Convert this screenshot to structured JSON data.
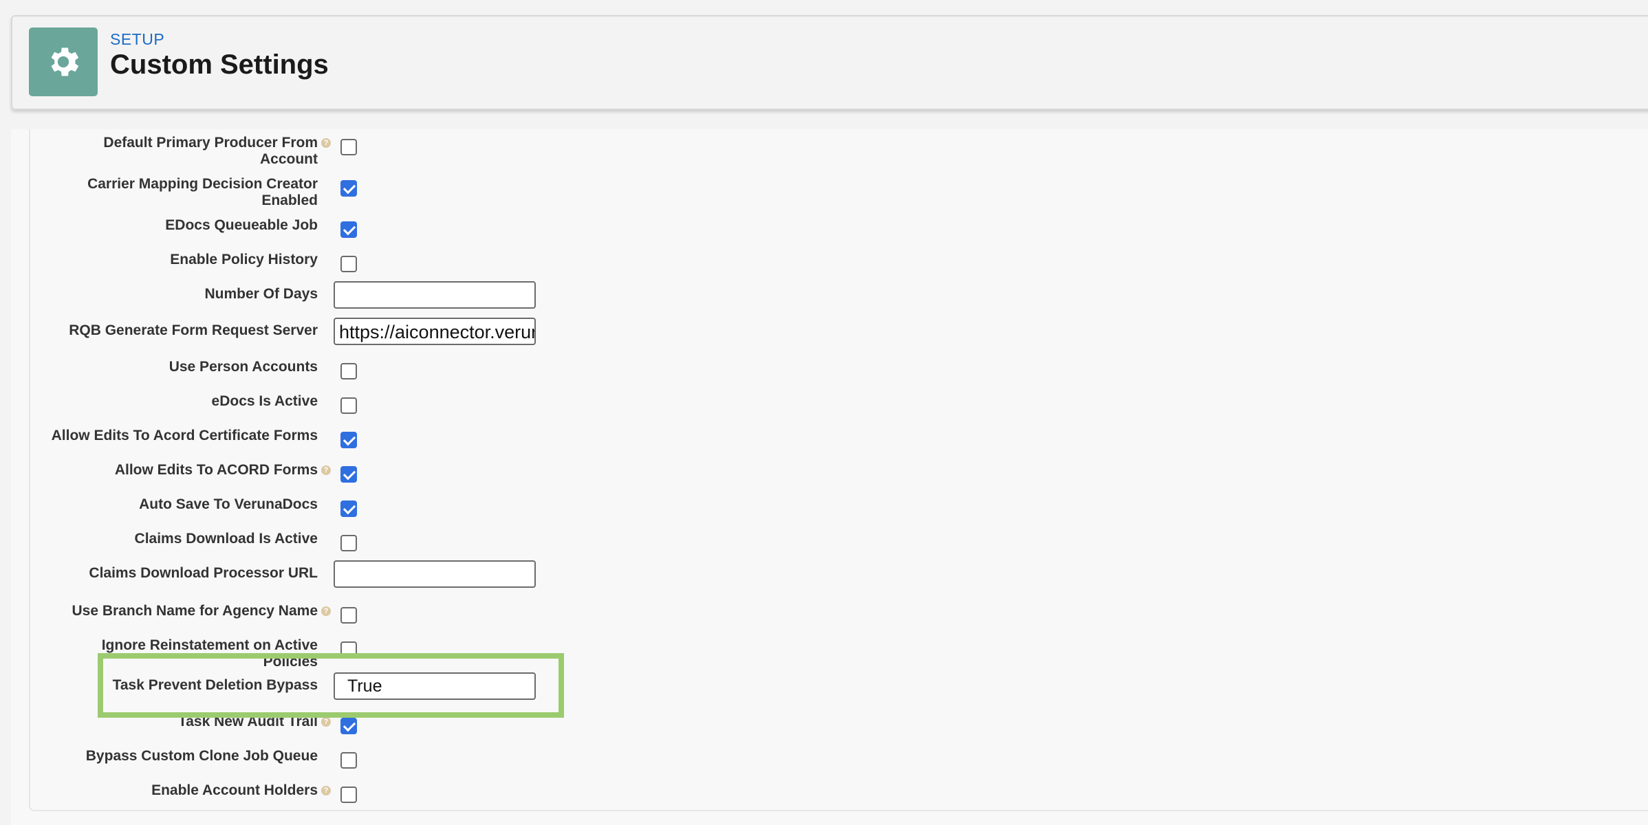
{
  "header": {
    "eyebrow": "SETUP",
    "title": "Custom Settings",
    "icon": "gear-icon"
  },
  "fields": [
    {
      "label_line1": "Default Primary Producer From",
      "label_line2": "Account",
      "type": "checkbox",
      "checked": false,
      "help": true
    },
    {
      "label_line1": "Carrier Mapping Decision Creator",
      "label_line2": "Enabled",
      "type": "checkbox",
      "checked": true,
      "help": false
    },
    {
      "label_line1": "EDocs Queueable Job",
      "label_line2": "",
      "type": "checkbox",
      "checked": true,
      "help": false
    },
    {
      "label_line1": "Enable Policy History",
      "label_line2": "",
      "type": "checkbox",
      "checked": false,
      "help": false
    },
    {
      "label_line1": "Number Of Days",
      "label_line2": "",
      "type": "text",
      "value": "",
      "help": false
    },
    {
      "label_line1": "RQB Generate Form Request Server",
      "label_line2": "",
      "type": "text",
      "value": "https://aiconnector.verun",
      "help": false
    },
    {
      "label_line1": "Use Person Accounts",
      "label_line2": "",
      "type": "checkbox",
      "checked": false,
      "help": false
    },
    {
      "label_line1": "eDocs Is Active",
      "label_line2": "",
      "type": "checkbox",
      "checked": false,
      "help": false
    },
    {
      "label_line1": "Allow Edits To Acord Certificate Forms",
      "label_line2": "",
      "type": "checkbox",
      "checked": true,
      "help": false
    },
    {
      "label_line1": "Allow Edits To ACORD Forms",
      "label_line2": "",
      "type": "checkbox",
      "checked": true,
      "help": true
    },
    {
      "label_line1": "Auto Save To VerunaDocs",
      "label_line2": "",
      "type": "checkbox",
      "checked": true,
      "help": false
    },
    {
      "label_line1": "Claims Download Is Active",
      "label_line2": "",
      "type": "checkbox",
      "checked": false,
      "help": false
    },
    {
      "label_line1": "Claims Download Processor URL",
      "label_line2": "",
      "type": "text",
      "value": "",
      "help": false
    },
    {
      "label_line1": "Use Branch Name for Agency Name",
      "label_line2": "",
      "type": "checkbox",
      "checked": false,
      "help": true
    },
    {
      "label_line1": "Ignore Reinstatement on Active",
      "label_line2": "Policies",
      "type": "checkbox",
      "checked": false,
      "help": false
    },
    {
      "label_line1": "Task Prevent Deletion Bypass",
      "label_line2": "",
      "type": "text",
      "value": "True",
      "help": false
    },
    {
      "label_line1": "Task New Audit Trail",
      "label_line2": "",
      "type": "checkbox",
      "checked": true,
      "help": true
    },
    {
      "label_line1": "Bypass Custom Clone Job Queue",
      "label_line2": "",
      "type": "checkbox",
      "checked": false,
      "help": false
    },
    {
      "label_line1": "Enable Account Holders",
      "label_line2": "",
      "type": "checkbox",
      "checked": false,
      "help": true
    }
  ],
  "help_glyph": "?",
  "highlight_color": "#9ccb6f",
  "accent_color": "#2f6fe0"
}
